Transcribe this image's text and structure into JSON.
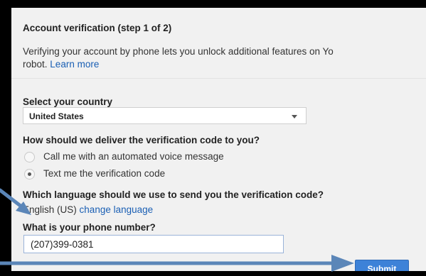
{
  "header": {
    "title": "Account verification (step 1 of 2)",
    "description_line1": "Verifying your account by phone lets you unlock additional features on Yo",
    "description_line2": "robot.",
    "learn_more": "Learn more"
  },
  "country": {
    "label": "Select your country",
    "selected": "United States"
  },
  "delivery": {
    "question": "How should we deliver the verification code to you?",
    "options": [
      {
        "label": "Call me with an automated voice message",
        "checked": false
      },
      {
        "label": "Text me the verification code",
        "checked": true
      }
    ]
  },
  "language": {
    "question": "Which language should we use to send you the verification code?",
    "current": "English (US)",
    "change_link": "change language"
  },
  "phone": {
    "label": "What is your phone number?",
    "value": "(207)399-0381"
  },
  "actions": {
    "submit_label": "Submit"
  },
  "colors": {
    "arrow": "#5b86b8",
    "link": "#1a5fb4",
    "button": "#3d82d8"
  }
}
